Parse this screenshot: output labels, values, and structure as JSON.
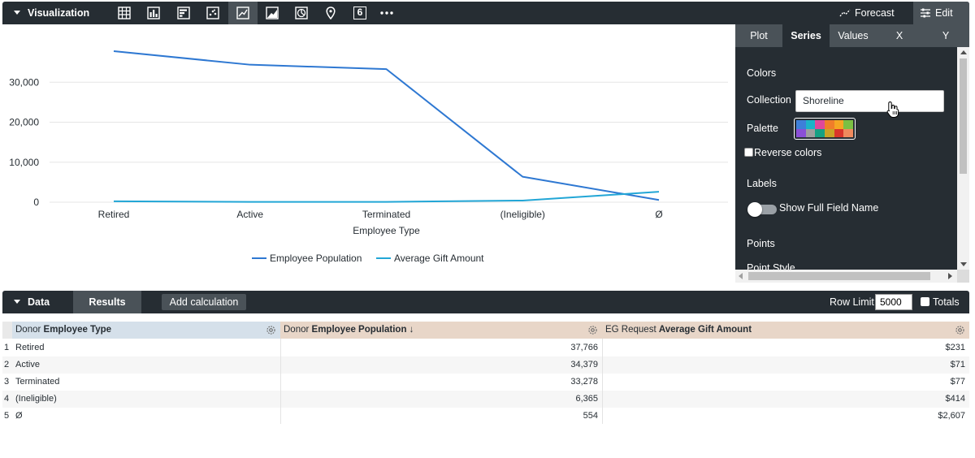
{
  "visualization": {
    "title": "Visualization",
    "tools": [
      {
        "icon": "table-icon"
      },
      {
        "icon": "column-chart-icon"
      },
      {
        "icon": "bar-chart-icon"
      },
      {
        "icon": "scatter-icon"
      },
      {
        "icon": "line-chart-icon"
      },
      {
        "icon": "area-chart-icon"
      },
      {
        "icon": "pie-chart-icon"
      },
      {
        "icon": "map-pin-icon"
      },
      {
        "icon": "single-value-icon",
        "label": "6"
      },
      {
        "icon": "more-icon"
      }
    ],
    "active_tool": "line-chart-icon",
    "forecast_label": "Forecast",
    "edit_label": "Edit"
  },
  "chart_data": {
    "type": "line",
    "categories": [
      "Retired",
      "Active",
      "Terminated",
      "(Ineligible)",
      "Ø"
    ],
    "series": [
      {
        "name": "Employee Population",
        "values": [
          37766,
          34379,
          33278,
          6365,
          554
        ],
        "color": "#2e78d2"
      },
      {
        "name": "Average Gift Amount",
        "values": [
          231,
          71,
          77,
          414,
          2607
        ],
        "color": "#22a6d6"
      }
    ],
    "xlabel": "Employee Type",
    "ylabel": "",
    "yticks": [
      0,
      10000,
      20000,
      30000
    ],
    "ytick_labels": [
      "0",
      "10,000",
      "20,000",
      "30,000"
    ],
    "ylim": [
      0,
      40000
    ],
    "grid": true,
    "legend": "bottom-center"
  },
  "edit_panel": {
    "tabs": [
      "Plot",
      "Series",
      "Values",
      "X",
      "Y"
    ],
    "active_tab": "Series",
    "colors_heading": "Colors",
    "collection_label": "Collection",
    "collection_value": "Shoreline",
    "palette_label": "Palette",
    "palette_colors": [
      "#3d7fd9",
      "#1cb3c8",
      "#e0489b",
      "#f07d2a",
      "#f5a623",
      "#7bc043",
      "#8a4fd6",
      "#9e9e9e",
      "#16a083",
      "#c9a227",
      "#d9352b",
      "#f08a5d"
    ],
    "reverse_colors_label": "Reverse colors",
    "labels_heading": "Labels",
    "show_full_field_name_label": "Show Full Field Name",
    "points_heading": "Points",
    "point_style_label": "Point Style"
  },
  "data_bar": {
    "title": "Data",
    "results_tab": "Results",
    "add_calculation": "Add calculation",
    "row_limit_label": "Row Limit",
    "row_limit_value": "5000",
    "totals_label": "Totals"
  },
  "table": {
    "columns": [
      {
        "prefix": "Donor",
        "name": "Employee Type",
        "sort": "",
        "bg": "#d5e0ea"
      },
      {
        "prefix": "Donor",
        "name": "Employee Population",
        "sort": "↓",
        "bg": "#e8d6c8"
      },
      {
        "prefix": "EG Request",
        "name": "Average Gift Amount",
        "sort": "",
        "bg": "#e8d6c8"
      }
    ],
    "rows": [
      {
        "n": "1",
        "type": "Retired",
        "pop": "37,766",
        "gift": "$231"
      },
      {
        "n": "2",
        "type": "Active",
        "pop": "34,379",
        "gift": "$71"
      },
      {
        "n": "3",
        "type": "Terminated",
        "pop": "33,278",
        "gift": "$77"
      },
      {
        "n": "4",
        "type": "(Ineligible)",
        "pop": "6,365",
        "gift": "$414"
      },
      {
        "n": "5",
        "type": "Ø",
        "pop": "554",
        "gift": "$2,607"
      }
    ]
  }
}
